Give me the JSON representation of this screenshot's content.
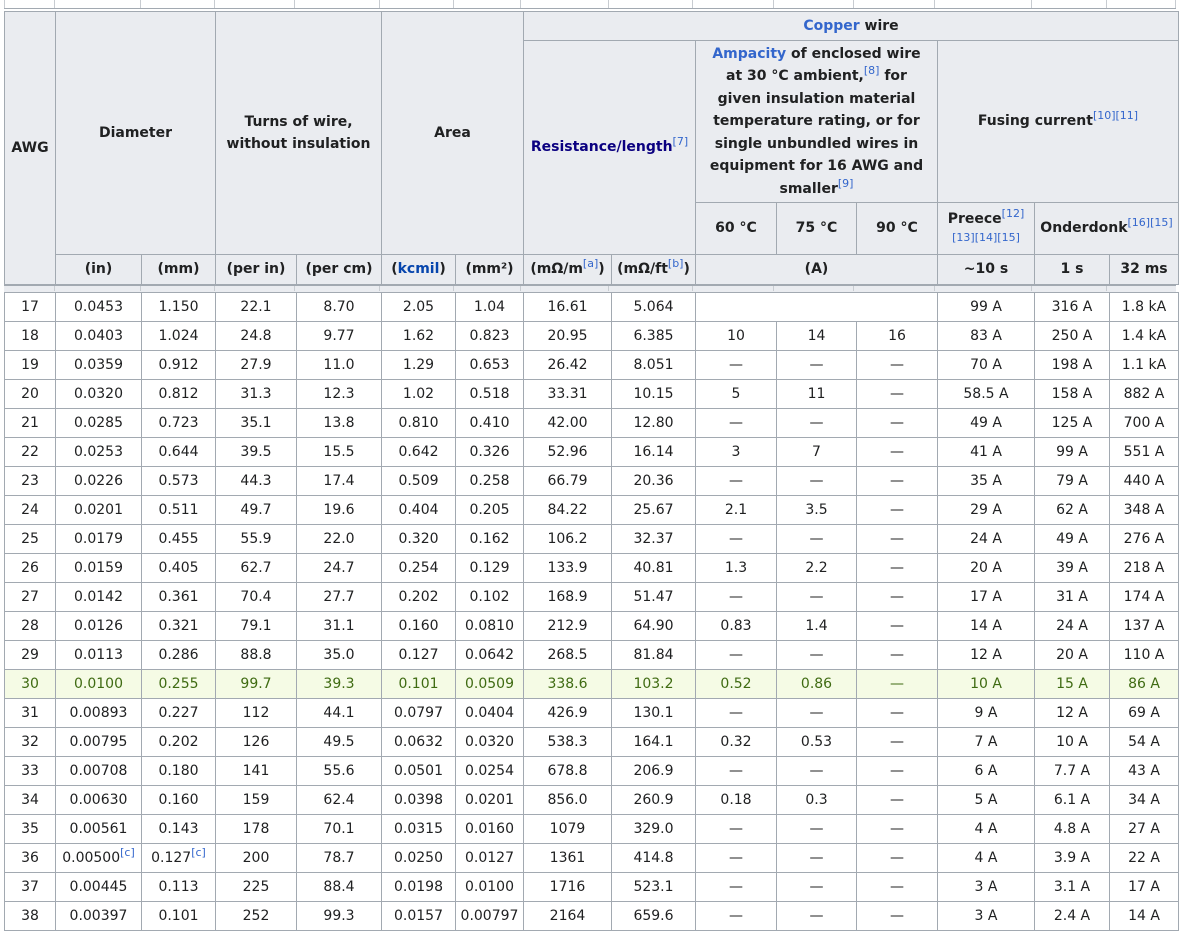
{
  "header": {
    "awg": "AWG",
    "diameter": "Diameter",
    "turns": "Turns of wire, without insulation",
    "area": "Area",
    "copper_link": "Copper",
    "copper_rest": " wire",
    "resistance": "Resistance/length",
    "resistance_ref": "[7]",
    "ampacity_link": "Ampacity",
    "ampacity_text1": " of enclosed wire at 30 °C ambient,",
    "ampacity_ref8": "[8]",
    "ampacity_text2": " for given insulation material temperature rating, or for single unbundled wires in equipment for 16 AWG and smaller",
    "ampacity_ref9": "[9]",
    "fusing": "Fusing current",
    "fusing_refs": "[10][11]",
    "temp60": "60 °C",
    "temp75": "75 °C",
    "temp90": "90 °C",
    "preece": "Preece",
    "preece_ref12": "[12]",
    "preece_refs2": "[13][14][15]",
    "onderdonk": "Onderdonk",
    "onderdonk_refs": "[16][15]"
  },
  "units": {
    "in": "(in)",
    "mm": "(mm)",
    "per_in": "(per in)",
    "per_cm": "(per cm)",
    "kcmil_open": "(",
    "kcmil": "kcmil",
    "kcmil_close": ")",
    "mm2": "(mm²)",
    "mohm_m": "(mΩ/m",
    "note_a": "[a]",
    "mohm_ft": "(mΩ/ft",
    "note_b": "[b]",
    "close": ")",
    "amps": "(A)",
    "t10s": "~10 s",
    "t1s": "1 s",
    "t32ms": "32 ms"
  },
  "rows": [
    {
      "awg": "17",
      "in": "0.0453",
      "mm": "1.150",
      "per_in": "22.1",
      "per_cm": "8.70",
      "kcmil": "2.05",
      "mm2": "1.04",
      "mohm_m": "16.61",
      "mohm_ft": "5.064",
      "c60": "",
      "c75": "",
      "c90": "",
      "preece": "99 A",
      "onder1": "316 A",
      "onder32": "1.8 kA"
    },
    {
      "awg": "18",
      "in": "0.0403",
      "mm": "1.024",
      "per_in": "24.8",
      "per_cm": "9.77",
      "kcmil": "1.62",
      "mm2": "0.823",
      "mohm_m": "20.95",
      "mohm_ft": "6.385",
      "c60": "10",
      "c75": "14",
      "c90": "16",
      "preece": "83 A",
      "onder1": "250 A",
      "onder32": "1.4 kA"
    },
    {
      "awg": "19",
      "in": "0.0359",
      "mm": "0.912",
      "per_in": "27.9",
      "per_cm": "11.0",
      "kcmil": "1.29",
      "mm2": "0.653",
      "mohm_m": "26.42",
      "mohm_ft": "8.051",
      "c60": "—",
      "c75": "—",
      "c90": "—",
      "preece": "70 A",
      "onder1": "198 A",
      "onder32": "1.1 kA"
    },
    {
      "awg": "20",
      "in": "0.0320",
      "mm": "0.812",
      "per_in": "31.3",
      "per_cm": "12.3",
      "kcmil": "1.02",
      "mm2": "0.518",
      "mohm_m": "33.31",
      "mohm_ft": "10.15",
      "c60": "5",
      "c75": "11",
      "c90": "—",
      "preece": "58.5 A",
      "onder1": "158 A",
      "onder32": "882 A"
    },
    {
      "awg": "21",
      "in": "0.0285",
      "mm": "0.723",
      "per_in": "35.1",
      "per_cm": "13.8",
      "kcmil": "0.810",
      "mm2": "0.410",
      "mohm_m": "42.00",
      "mohm_ft": "12.80",
      "c60": "—",
      "c75": "—",
      "c90": "—",
      "preece": "49 A",
      "onder1": "125 A",
      "onder32": "700 A"
    },
    {
      "awg": "22",
      "in": "0.0253",
      "mm": "0.644",
      "per_in": "39.5",
      "per_cm": "15.5",
      "kcmil": "0.642",
      "mm2": "0.326",
      "mohm_m": "52.96",
      "mohm_ft": "16.14",
      "c60": "3",
      "c75": "7",
      "c90": "—",
      "preece": "41 A",
      "onder1": "99 A",
      "onder32": "551 A"
    },
    {
      "awg": "23",
      "in": "0.0226",
      "mm": "0.573",
      "per_in": "44.3",
      "per_cm": "17.4",
      "kcmil": "0.509",
      "mm2": "0.258",
      "mohm_m": "66.79",
      "mohm_ft": "20.36",
      "c60": "—",
      "c75": "—",
      "c90": "—",
      "preece": "35 A",
      "onder1": "79 A",
      "onder32": "440 A"
    },
    {
      "awg": "24",
      "in": "0.0201",
      "mm": "0.511",
      "per_in": "49.7",
      "per_cm": "19.6",
      "kcmil": "0.404",
      "mm2": "0.205",
      "mohm_m": "84.22",
      "mohm_ft": "25.67",
      "c60": "2.1",
      "c75": "3.5",
      "c90": "—",
      "preece": "29 A",
      "onder1": "62 A",
      "onder32": "348 A"
    },
    {
      "awg": "25",
      "in": "0.0179",
      "mm": "0.455",
      "per_in": "55.9",
      "per_cm": "22.0",
      "kcmil": "0.320",
      "mm2": "0.162",
      "mohm_m": "106.2",
      "mohm_ft": "32.37",
      "c60": "—",
      "c75": "—",
      "c90": "—",
      "preece": "24 A",
      "onder1": "49 A",
      "onder32": "276 A"
    },
    {
      "awg": "26",
      "in": "0.0159",
      "mm": "0.405",
      "per_in": "62.7",
      "per_cm": "24.7",
      "kcmil": "0.254",
      "mm2": "0.129",
      "mohm_m": "133.9",
      "mohm_ft": "40.81",
      "c60": "1.3",
      "c75": "2.2",
      "c90": "—",
      "preece": "20 A",
      "onder1": "39 A",
      "onder32": "218 A"
    },
    {
      "awg": "27",
      "in": "0.0142",
      "mm": "0.361",
      "per_in": "70.4",
      "per_cm": "27.7",
      "kcmil": "0.202",
      "mm2": "0.102",
      "mohm_m": "168.9",
      "mohm_ft": "51.47",
      "c60": "—",
      "c75": "—",
      "c90": "—",
      "preece": "17 A",
      "onder1": "31 A",
      "onder32": "174 A"
    },
    {
      "awg": "28",
      "in": "0.0126",
      "mm": "0.321",
      "per_in": "79.1",
      "per_cm": "31.1",
      "kcmil": "0.160",
      "mm2": "0.0810",
      "mohm_m": "212.9",
      "mohm_ft": "64.90",
      "c60": "0.83",
      "c75": "1.4",
      "c90": "—",
      "preece": "14 A",
      "onder1": "24 A",
      "onder32": "137 A"
    },
    {
      "awg": "29",
      "in": "0.0113",
      "mm": "0.286",
      "per_in": "88.8",
      "per_cm": "35.0",
      "kcmil": "0.127",
      "mm2": "0.0642",
      "mohm_m": "268.5",
      "mohm_ft": "81.84",
      "c60": "—",
      "c75": "—",
      "c90": "—",
      "preece": "12 A",
      "onder1": "20 A",
      "onder32": "110 A"
    },
    {
      "awg": "30",
      "in": "0.0100",
      "mm": "0.255",
      "per_in": "99.7",
      "per_cm": "39.3",
      "kcmil": "0.101",
      "mm2": "0.0509",
      "mohm_m": "338.6",
      "mohm_ft": "103.2",
      "c60": "0.52",
      "c75": "0.86",
      "c90": "—",
      "preece": "10 A",
      "onder1": "15 A",
      "onder32": "86 A",
      "highlight": true
    },
    {
      "awg": "31",
      "in": "0.00893",
      "mm": "0.227",
      "per_in": "112",
      "per_cm": "44.1",
      "kcmil": "0.0797",
      "mm2": "0.0404",
      "mohm_m": "426.9",
      "mohm_ft": "130.1",
      "c60": "—",
      "c75": "—",
      "c90": "—",
      "preece": "9 A",
      "onder1": "12 A",
      "onder32": "69 A"
    },
    {
      "awg": "32",
      "in": "0.00795",
      "mm": "0.202",
      "per_in": "126",
      "per_cm": "49.5",
      "kcmil": "0.0632",
      "mm2": "0.0320",
      "mohm_m": "538.3",
      "mohm_ft": "164.1",
      "c60": "0.32",
      "c75": "0.53",
      "c90": "—",
      "preece": "7 A",
      "onder1": "10 A",
      "onder32": "54 A"
    },
    {
      "awg": "33",
      "in": "0.00708",
      "mm": "0.180",
      "per_in": "141",
      "per_cm": "55.6",
      "kcmil": "0.0501",
      "mm2": "0.0254",
      "mohm_m": "678.8",
      "mohm_ft": "206.9",
      "c60": "—",
      "c75": "—",
      "c90": "—",
      "preece": "6 A",
      "onder1": "7.7 A",
      "onder32": "43 A"
    },
    {
      "awg": "34",
      "in": "0.00630",
      "mm": "0.160",
      "per_in": "159",
      "per_cm": "62.4",
      "kcmil": "0.0398",
      "mm2": "0.0201",
      "mohm_m": "856.0",
      "mohm_ft": "260.9",
      "c60": "0.18",
      "c75": "0.3",
      "c90": "—",
      "preece": "5 A",
      "onder1": "6.1 A",
      "onder32": "34 A"
    },
    {
      "awg": "35",
      "in": "0.00561",
      "mm": "0.143",
      "per_in": "178",
      "per_cm": "70.1",
      "kcmil": "0.0315",
      "mm2": "0.0160",
      "mohm_m": "1079",
      "mohm_ft": "329.0",
      "c60": "—",
      "c75": "—",
      "c90": "—",
      "preece": "4 A",
      "onder1": "4.8 A",
      "onder32": "27 A"
    },
    {
      "awg": "36",
      "in": "0.00500",
      "in_note": "[c]",
      "mm": "0.127",
      "mm_note": "[c]",
      "per_in": "200",
      "per_cm": "78.7",
      "kcmil": "0.0250",
      "mm2": "0.0127",
      "mohm_m": "1361",
      "mohm_ft": "414.8",
      "c60": "—",
      "c75": "—",
      "c90": "—",
      "preece": "4 A",
      "onder1": "3.9 A",
      "onder32": "22 A"
    },
    {
      "awg": "37",
      "in": "0.00445",
      "mm": "0.113",
      "per_in": "225",
      "per_cm": "88.4",
      "kcmil": "0.0198",
      "mm2": "0.0100",
      "mohm_m": "1716",
      "mohm_ft": "523.1",
      "c60": "—",
      "c75": "—",
      "c90": "—",
      "preece": "3 A",
      "onder1": "3.1 A",
      "onder32": "17 A"
    },
    {
      "awg": "38",
      "in": "0.00397",
      "mm": "0.101",
      "per_in": "252",
      "per_cm": "99.3",
      "kcmil": "0.0157",
      "mm2": "0.00797",
      "mohm_m": "2164",
      "mohm_ft": "659.6",
      "c60": "—",
      "c75": "—",
      "c90": "—",
      "preece": "3 A",
      "onder1": "2.4 A",
      "onder32": "14 A"
    }
  ],
  "colors": {
    "header_bg": "#eaecf0",
    "border": "#a2a9b1",
    "link": "#3366cc",
    "highlight_bg": "#f5fbe5",
    "highlight_text": "#3f6b12"
  }
}
